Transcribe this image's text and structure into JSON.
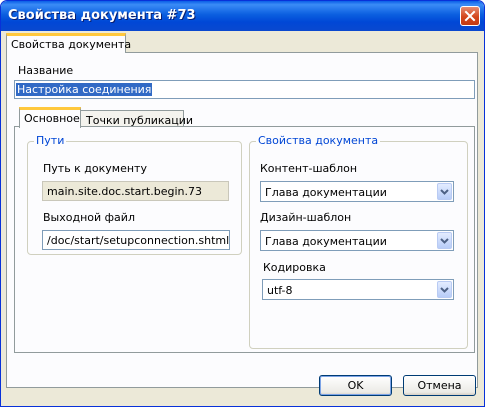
{
  "window": {
    "title": "Свойства документа #73"
  },
  "top_tabs": [
    {
      "label": "Свойства документа"
    }
  ],
  "name_field": {
    "label": "Название",
    "value": "Настройка соединения"
  },
  "inner_tabs": [
    {
      "label": "Основное"
    },
    {
      "label": "Точки публикации"
    }
  ],
  "paths_group": {
    "legend": "Пути",
    "doc_path_label": "Путь к документу",
    "doc_path_value": "main.site.doc.start.begin.73",
    "output_file_label": "Выходной файл",
    "output_file_value": "/doc/start/setupconnection.shtml"
  },
  "doc_props_group": {
    "legend": "Свойства документа",
    "content_template_label": "Контент-шаблон",
    "content_template_value": "Глава документации",
    "design_template_label": "Дизайн-шаблон",
    "design_template_value": "Глава документации",
    "encoding_label": "Кодировка",
    "encoding_value": "utf-8"
  },
  "buttons": {
    "ok": "OK",
    "cancel": "Отмена"
  },
  "icons": {
    "close": "close-icon",
    "dropdown": "chevron-down-icon"
  }
}
